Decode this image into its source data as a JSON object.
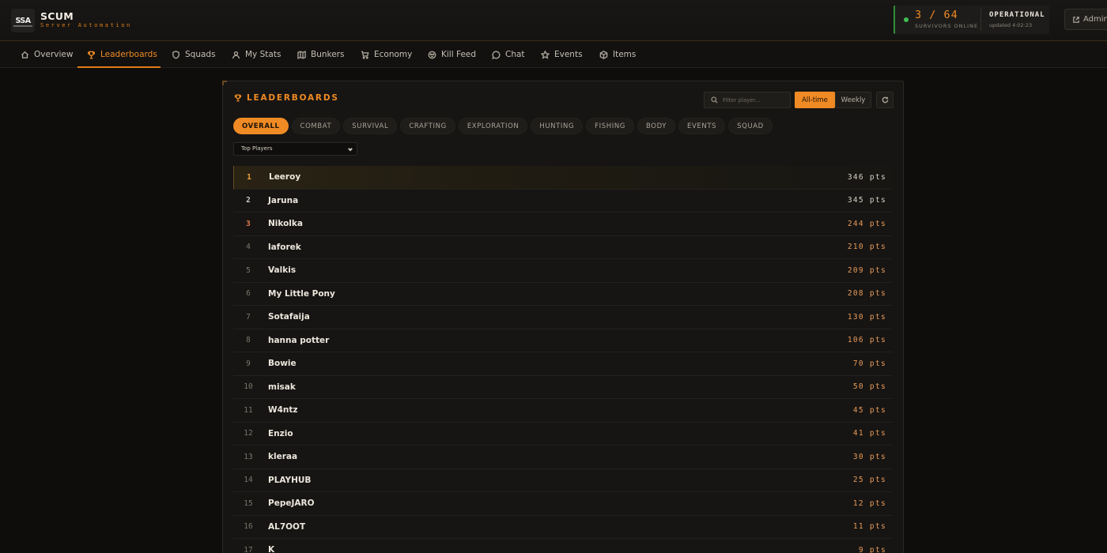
{
  "header": {
    "logo_text": "SSA",
    "title": "SCUM",
    "subtitle": "Server Automation",
    "status": {
      "count": "3 / 64",
      "count_label": "SURVIVORS ONLINE",
      "state": "OPERATIONAL",
      "updated": "updated 4:02:23"
    },
    "admin_label": "Admin"
  },
  "nav": {
    "items": [
      {
        "label": "Overview",
        "icon": "home-icon"
      },
      {
        "label": "Leaderboards",
        "icon": "trophy-icon"
      },
      {
        "label": "Squads",
        "icon": "shield-icon"
      },
      {
        "label": "My Stats",
        "icon": "user-icon"
      },
      {
        "label": "Bunkers",
        "icon": "map-icon"
      },
      {
        "label": "Economy",
        "icon": "cart-icon"
      },
      {
        "label": "Kill Feed",
        "icon": "skull-icon"
      },
      {
        "label": "Chat",
        "icon": "chat-icon"
      },
      {
        "label": "Events",
        "icon": "star-icon"
      },
      {
        "label": "Items",
        "icon": "box-icon"
      }
    ],
    "active": "Leaderboards"
  },
  "panel": {
    "title": "LEADERBOARDS",
    "filter_placeholder": "Filter player...",
    "period_options": [
      "All-time",
      "Weekly"
    ],
    "period_selected": "All-time",
    "categories": [
      "OVERALL",
      "COMBAT",
      "SURVIVAL",
      "CRAFTING",
      "EXPLORATION",
      "HUNTING",
      "FISHING",
      "BODY",
      "EVENTS",
      "SQUAD"
    ],
    "category_selected": "OVERALL",
    "board_select": "Top Players",
    "rows": [
      {
        "rank": "1",
        "name": "Leeroy",
        "pts": "346 pts"
      },
      {
        "rank": "2",
        "name": "Jaruna",
        "pts": "345 pts"
      },
      {
        "rank": "3",
        "name": "Nikolka",
        "pts": "244 pts"
      },
      {
        "rank": "4",
        "name": "laforek",
        "pts": "210 pts"
      },
      {
        "rank": "5",
        "name": "Valkis",
        "pts": "209 pts"
      },
      {
        "rank": "6",
        "name": "My Little Pony",
        "pts": "208 pts"
      },
      {
        "rank": "7",
        "name": "Sotafaija",
        "pts": "130 pts"
      },
      {
        "rank": "8",
        "name": "hanna potter",
        "pts": "106 pts"
      },
      {
        "rank": "9",
        "name": "Bowie",
        "pts": "70 pts"
      },
      {
        "rank": "10",
        "name": "misak",
        "pts": "50 pts"
      },
      {
        "rank": "11",
        "name": "W4ntz",
        "pts": "45 pts"
      },
      {
        "rank": "12",
        "name": "Enzio",
        "pts": "41 pts"
      },
      {
        "rank": "13",
        "name": "kleraa",
        "pts": "30 pts"
      },
      {
        "rank": "14",
        "name": "PLAYHUB",
        "pts": "25 pts"
      },
      {
        "rank": "15",
        "name": "PepeJARO",
        "pts": "12 pts"
      },
      {
        "rank": "16",
        "name": "AL7OOT",
        "pts": "11 pts"
      },
      {
        "rank": "17",
        "name": "K",
        "pts": "9 pts"
      }
    ]
  },
  "colors": {
    "accent": "#f08a24",
    "online": "#3fbf4f",
    "background": "#0e0d0b"
  }
}
